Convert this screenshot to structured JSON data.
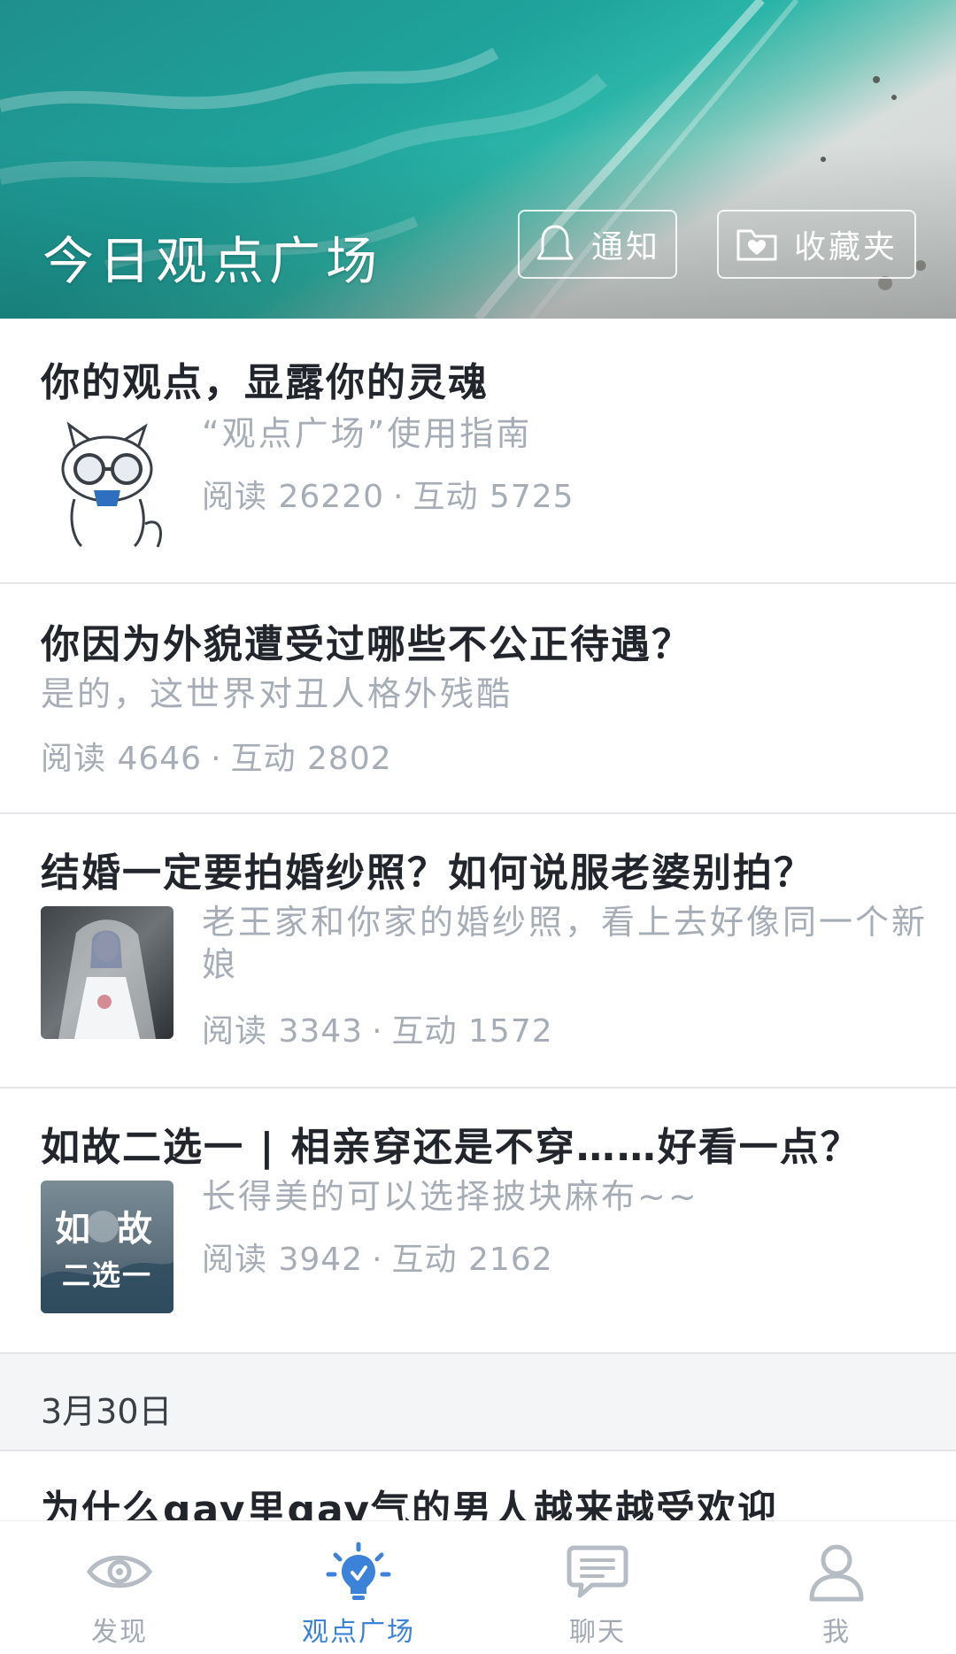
{
  "header": {
    "title": "今日观点广场",
    "notify_label": "通知",
    "favorites_label": "收藏夹"
  },
  "feed": [
    {
      "title": "你的观点，显露你的灵魂",
      "subtitle": "“观点广场”使用指南",
      "reads_label": "阅读",
      "reads": "26220",
      "interactions_label": "互动",
      "interactions": "5725",
      "thumb": "cat-mascot-with-glasses"
    },
    {
      "title": "你因为外貌遭受过哪些不公正待遇？",
      "subtitle": "是的，这世界对丑人格外残酷",
      "reads_label": "阅读",
      "reads": "4646",
      "interactions_label": "互动",
      "interactions": "2802"
    },
    {
      "title": "结婚一定要拍婚纱照？如何说服老婆别拍？",
      "subtitle": "老王家和你家的婚纱照，看上去好像同一个新娘",
      "reads_label": "阅读",
      "reads": "3343",
      "interactions_label": "互动",
      "interactions": "1572",
      "thumb": "bride-photo"
    },
    {
      "title": "如故二选一 | 相亲穿还是不穿……好看一点？",
      "subtitle": "长得美的可以选择披块麻布~~",
      "reads_label": "阅读",
      "reads": "3942",
      "interactions_label": "互动",
      "interactions": "2162",
      "thumb": "rugu-choose-one",
      "thumb_text_top": "如 故",
      "thumb_text_bottom": "二选一"
    }
  ],
  "date_section": "3月30日",
  "partial_item_title": "为什么gay里gay气的男人越来越受欢迎",
  "nav": [
    {
      "label": "发现",
      "icon": "eye-icon",
      "active": false
    },
    {
      "label": "观点广场",
      "icon": "lightbulb-icon",
      "active": true
    },
    {
      "label": "聊天",
      "icon": "chat-bubble-icon",
      "active": false
    },
    {
      "label": "我",
      "icon": "user-icon",
      "active": false
    }
  ],
  "colors": {
    "accent": "#3b82d8",
    "muted_text": "#a6adb6",
    "title_text": "#22262c",
    "divider": "#e3e5e8"
  }
}
